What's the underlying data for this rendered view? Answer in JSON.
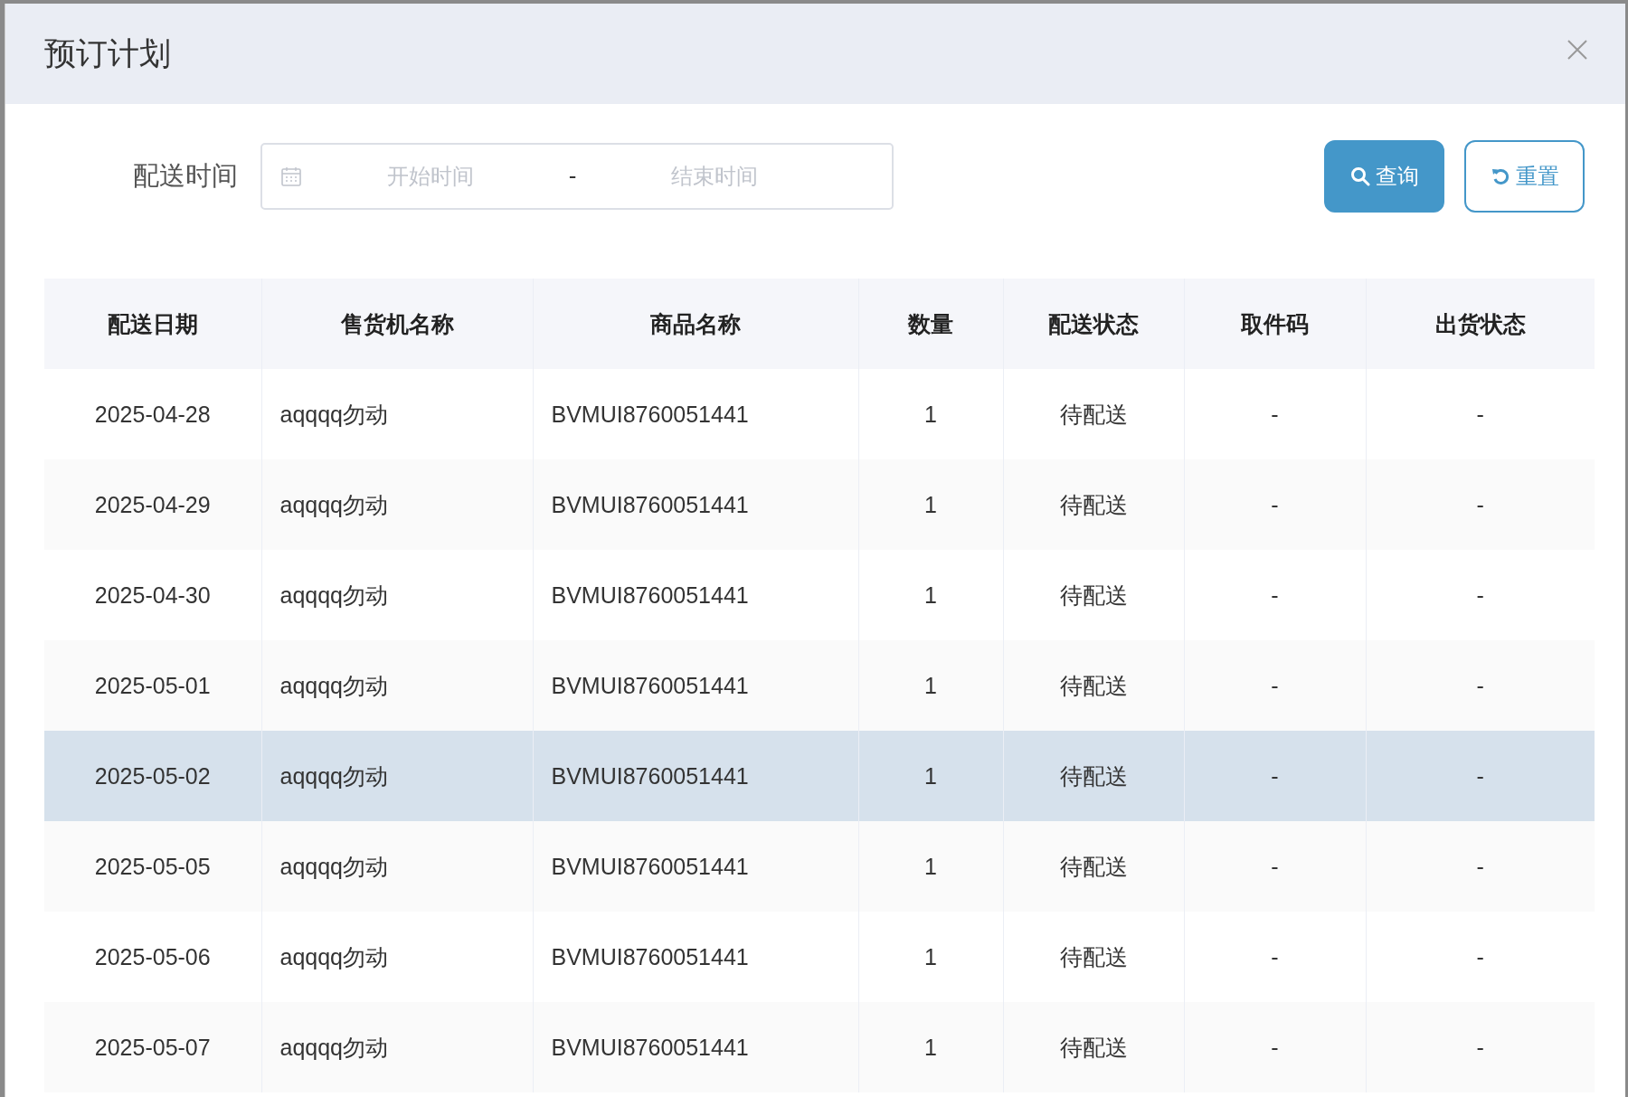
{
  "dialog": {
    "title": "预订计划"
  },
  "filter": {
    "label": "配送时间",
    "start_placeholder": "开始时间",
    "separator": "-",
    "end_placeholder": "结束时间"
  },
  "buttons": [
    {
      "kind": "primary",
      "label": "查询"
    },
    {
      "kind": "secondary",
      "label": "重置"
    }
  ],
  "table": {
    "columns": [
      "配送日期",
      "售货机名称",
      "商品名称",
      "数量",
      "配送状态",
      "取件码",
      "出货状态"
    ],
    "rows": [
      {
        "selected": false,
        "cells": [
          "2025-04-28",
          "aqqqq勿动",
          "BVMUI8760051441",
          "1",
          "待配送",
          "-",
          "-"
        ]
      },
      {
        "selected": false,
        "cells": [
          "2025-04-29",
          "aqqqq勿动",
          "BVMUI8760051441",
          "1",
          "待配送",
          "-",
          "-"
        ]
      },
      {
        "selected": false,
        "cells": [
          "2025-04-30",
          "aqqqq勿动",
          "BVMUI8760051441",
          "1",
          "待配送",
          "-",
          "-"
        ]
      },
      {
        "selected": false,
        "cells": [
          "2025-05-01",
          "aqqqq勿动",
          "BVMUI8760051441",
          "1",
          "待配送",
          "-",
          "-"
        ]
      },
      {
        "selected": true,
        "cells": [
          "2025-05-02",
          "aqqqq勿动",
          "BVMUI8760051441",
          "1",
          "待配送",
          "-",
          "-"
        ]
      },
      {
        "selected": false,
        "cells": [
          "2025-05-05",
          "aqqqq勿动",
          "BVMUI8760051441",
          "1",
          "待配送",
          "-",
          "-"
        ]
      },
      {
        "selected": false,
        "cells": [
          "2025-05-06",
          "aqqqq勿动",
          "BVMUI8760051441",
          "1",
          "待配送",
          "-",
          "-"
        ]
      },
      {
        "selected": false,
        "cells": [
          "2025-05-07",
          "aqqqq勿动",
          "BVMUI8760051441",
          "1",
          "待配送",
          "-",
          "-"
        ]
      }
    ]
  }
}
